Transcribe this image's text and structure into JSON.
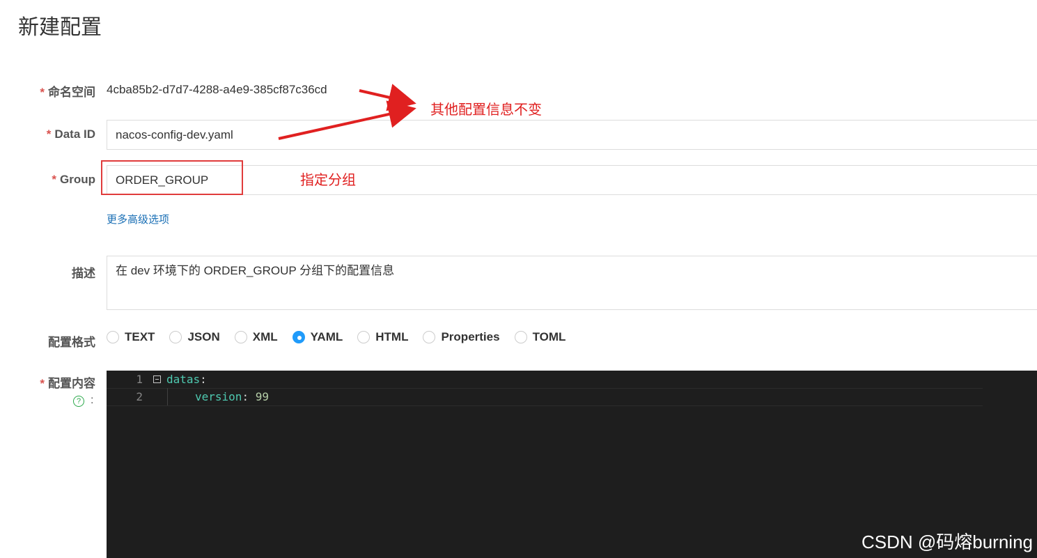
{
  "page": {
    "title": "新建配置"
  },
  "form": {
    "namespace": {
      "label": "命名空间",
      "value": "4cba85b2-d7d7-4288-a4e9-385cf87c36cd"
    },
    "data_id": {
      "label": "Data ID",
      "value": "nacos-config-dev.yaml"
    },
    "group": {
      "label": "Group",
      "value": "ORDER_GROUP"
    },
    "advanced_link": "更多高级选项",
    "description": {
      "label": "描述",
      "value": "在 dev 环境下的 ORDER_GROUP 分组下的配置信息"
    },
    "format": {
      "label": "配置格式",
      "options": [
        "TEXT",
        "JSON",
        "XML",
        "YAML",
        "HTML",
        "Properties",
        "TOML"
      ],
      "selected": "YAML"
    },
    "content": {
      "label": "配置内容",
      "help_icon": "?",
      "colon": ":",
      "lines": [
        {
          "number": "1",
          "key": "datas",
          "sep": ":",
          "value": ""
        },
        {
          "number": "2",
          "key": "version",
          "sep": ": ",
          "value": "99"
        }
      ]
    },
    "required_mark": "*"
  },
  "annotations": {
    "other_info": "其他配置信息不变",
    "group_hint": "指定分组",
    "color": "#e02020"
  },
  "watermark": "CSDN @码熔burning",
  "colors": {
    "accent": "#209bfa",
    "link": "#1a6fb5",
    "editor_bg": "#1e1e1e",
    "required": "#d9534f"
  }
}
